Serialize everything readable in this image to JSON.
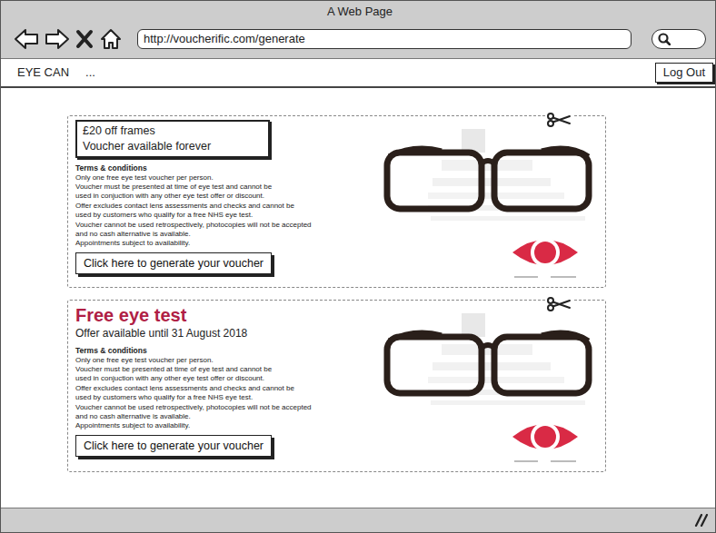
{
  "window": {
    "title": "A Web Page"
  },
  "address": {
    "url": "http://voucherific.com/generate"
  },
  "app": {
    "brand": "EYE CAN",
    "menu": "...",
    "logout": "Log Out"
  },
  "vouchers": [
    {
      "kind": "boxed",
      "title": "£20 off frames",
      "subtitle": "Voucher available forever",
      "terms_title": "Terms & conditions",
      "terms": [
        "Only one free eye test voucher per person.",
        "Voucher must be presented at time of eye test and cannot be",
        "used in conjuction with any other eye test offer or discount.",
        "Offer excludes contact lens assessments and checks and cannot be",
        "used by customers who qualify for a free NHS eye test.",
        "Voucher cannot be used retrospectively, photocopies will not be accepted",
        "and no cash alternative is available.",
        "Appointments subject to availability."
      ],
      "button": "Click here to generate your voucher"
    },
    {
      "kind": "headline",
      "title": "Free eye test",
      "subtitle": "Offer available until 31 August 2018",
      "terms_title": "Terms & conditions",
      "terms": [
        "Only one free eye test voucher per person.",
        "Voucher must be presented at time of eye test and cannot be",
        "used in conjuction with any other eye test offer or discount.",
        "Offer excludes contact lens assessments and checks and cannot be",
        "used by customers who qualify for a free NHS eye test.",
        "Voucher cannot be used retrospectively, photocopies will not be accepted",
        "and no cash alternative is available.",
        "Appointments subject to availability."
      ],
      "button": "Click here to generate your voucher"
    }
  ]
}
